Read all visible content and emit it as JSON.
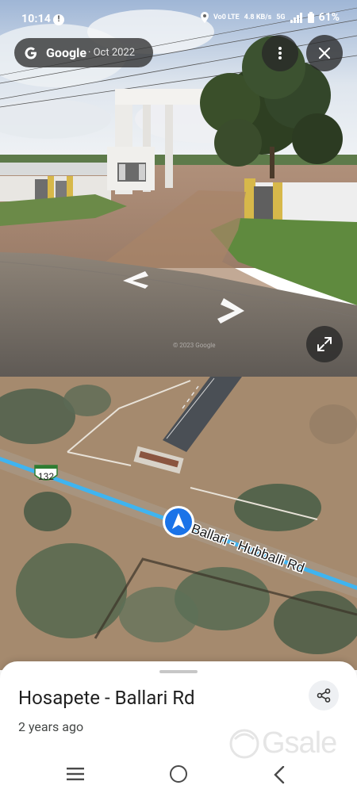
{
  "status_bar": {
    "time": "10:14",
    "network_speed": "4.8 KB/s",
    "network_type": "5G",
    "battery": "61%"
  },
  "street_view": {
    "source_label": "Google",
    "capture_date": "· Oct 2022",
    "image_credit": "© 2023 Google"
  },
  "map": {
    "route_shield": "132",
    "road_label": "Ballari - Hubballi Rd"
  },
  "place": {
    "title": "Hosapete - Ballari Rd",
    "age": "2 years ago"
  },
  "watermark": {
    "text": "Gsale"
  },
  "icons": {
    "status_info": "info-circle-icon",
    "location": "location-pin-icon",
    "signal": "signal-icon",
    "battery": "battery-icon",
    "more": "more-vert-icon",
    "close": "close-icon",
    "fullscreen": "fullscreen-icon",
    "share": "share-icon",
    "user_location": "navigation-arrow-icon"
  },
  "colors": {
    "road_highlight": "#3fb4f0",
    "location_marker": "#1a73e8",
    "overlay_dark": "#303030"
  }
}
